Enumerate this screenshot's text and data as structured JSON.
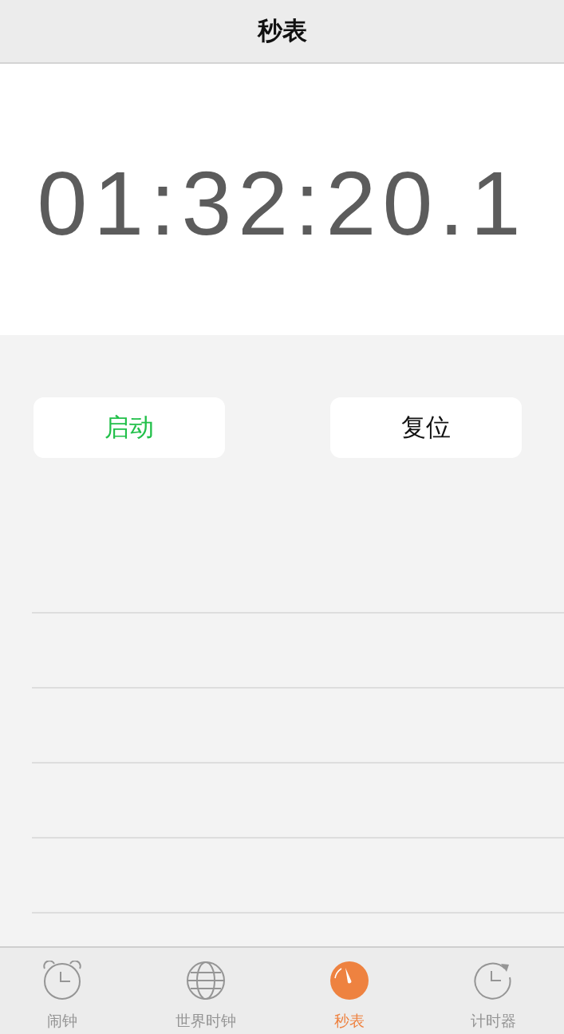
{
  "header": {
    "title": "秒表"
  },
  "display": {
    "time": "01:32:20.1"
  },
  "buttons": [
    {
      "label": "启动",
      "kind": "start"
    },
    {
      "label": "复位",
      "kind": "reset"
    }
  ],
  "tab_bar": {
    "tabs": [
      {
        "label": "闹钟",
        "kind": "alarm",
        "selected": false
      },
      {
        "label": "世界时钟",
        "kind": "world",
        "selected": false
      },
      {
        "label": "秒表",
        "kind": "stopwatch",
        "selected": true
      },
      {
        "label": "计时器",
        "kind": "timer",
        "selected": false
      }
    ]
  }
}
